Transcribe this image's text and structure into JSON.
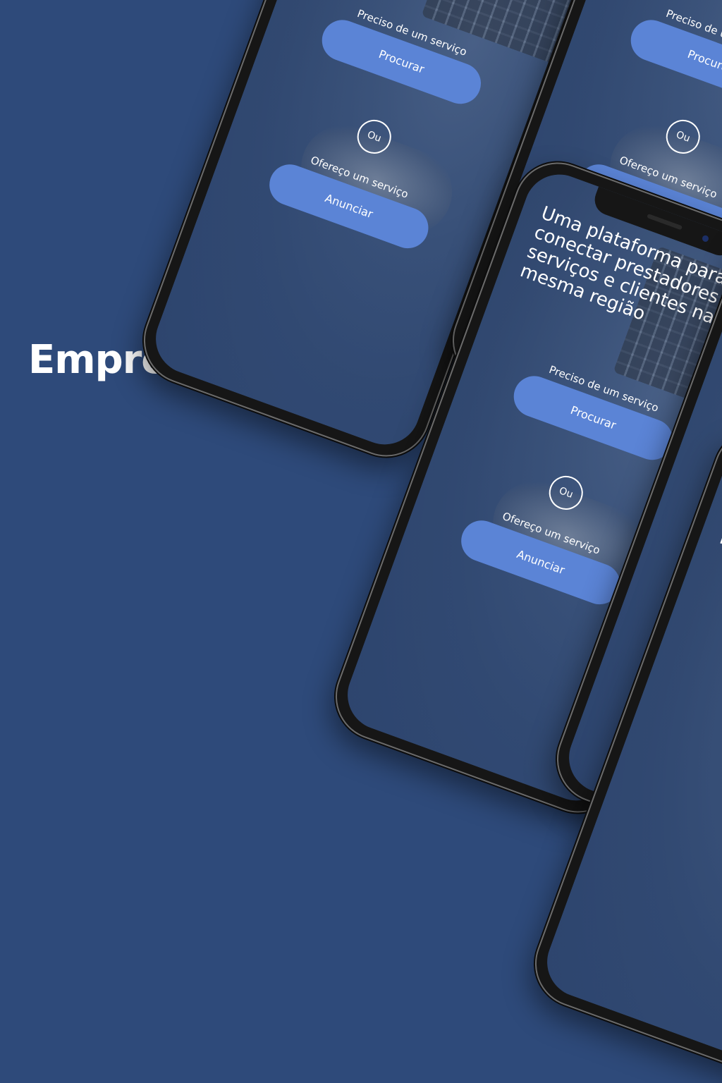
{
  "brand": {
    "name": "Empreende.ai"
  },
  "screen": {
    "headline": "Uma plataforma para conectar prestadores de serviços e clientes na mesma região",
    "need_prompt": "Preciso de um serviço",
    "search_button": "Procurar",
    "separator": "Ou",
    "offer_prompt": "Ofereço um serviço",
    "post_button": "Anunciar"
  },
  "colors": {
    "background": "#2e4a7a",
    "button": "#5b84d6",
    "text": "#ffffff"
  }
}
